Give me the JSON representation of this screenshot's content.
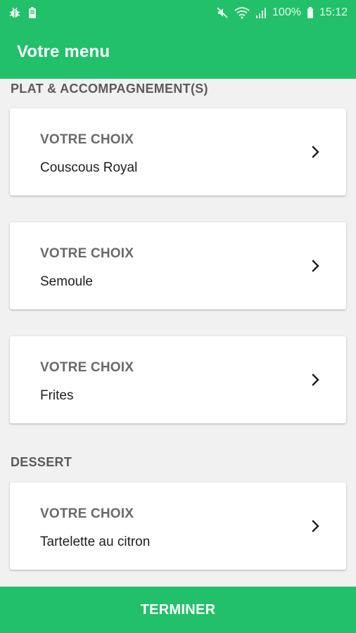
{
  "status_bar": {
    "battery_percent": "100%",
    "time": "15:12",
    "icons": [
      "bug-icon",
      "battery-small-icon",
      "mute-icon",
      "wifi-icon",
      "signal-icon",
      "battery-icon"
    ]
  },
  "app_bar": {
    "title": "Votre menu"
  },
  "sections": [
    {
      "title": "PLAT & ACCOMPAGNEMENT(S)",
      "items": [
        {
          "label": "VOTRE CHOIX",
          "value": "Couscous Royal"
        },
        {
          "label": "VOTRE CHOIX",
          "value": "Semoule"
        },
        {
          "label": "VOTRE CHOIX",
          "value": "Frites"
        }
      ]
    },
    {
      "title": "DESSERT",
      "items": [
        {
          "label": "VOTRE CHOIX",
          "value": "Tartelette au citron"
        }
      ]
    }
  ],
  "footer": {
    "button_label": "TERMINER"
  },
  "colors": {
    "primary": "#22c06a",
    "background": "#f1f1f1",
    "card": "#ffffff",
    "label": "#6a6a6a",
    "value": "#1e1e1e"
  }
}
